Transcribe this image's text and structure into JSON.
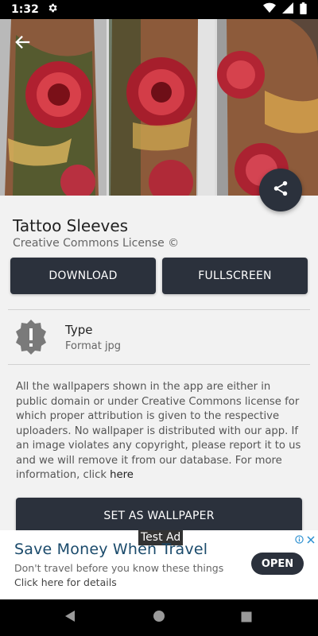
{
  "status_bar": {
    "time": "1:32"
  },
  "details": {
    "title": "Tattoo Sleeves",
    "license": "Creative Commons License ©",
    "download_label": "DOWNLOAD",
    "fullscreen_label": "FULLSCREEN",
    "type_label": "Type",
    "format_label": "Format jpg",
    "disclaimer": "All the wallpapers shown in the app are either in public domain or under Creative Commons license for which proper attribution is given to the respective uploaders. No wallpaper is distributed with our app. If an image violates any copyright, please report it to us and we will remove it from our database. For more information, click",
    "disclaimer_link": "here",
    "set_wallpaper_label": "SET AS WALLPAPER"
  },
  "ad": {
    "tag": "Test Ad",
    "headline": "Save Money When Travel",
    "description": "Don't travel before you know these things",
    "cta": "Click here for details",
    "open_label": "OPEN"
  },
  "icons": {
    "back": "arrow-back-icon",
    "share": "share-icon",
    "info": "alert-badge-icon",
    "settings": "gear-icon",
    "wifi": "wifi-icon",
    "signal": "signal-icon",
    "battery": "battery-icon"
  },
  "colors": {
    "button_bg": "#2b313c",
    "ad_headline": "#1a4a6b"
  }
}
